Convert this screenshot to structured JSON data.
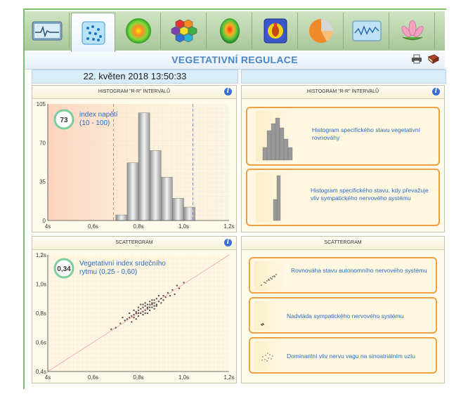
{
  "app": {
    "title": "VEGETATIVNÍ REGULACE",
    "date_left": "22. květen 2018 13:50:33"
  },
  "toolbar": {
    "buttons": [
      {
        "icon": "ecg-monitor-icon"
      },
      {
        "icon": "scatter-dots-icon",
        "active": true
      },
      {
        "icon": "green-circle-icon"
      },
      {
        "icon": "hexagon-cluster-icon"
      },
      {
        "icon": "heatmap-head-icon"
      },
      {
        "icon": "chakra-body-icon"
      },
      {
        "icon": "pie-chart-icon"
      },
      {
        "icon": "waveform-icon"
      },
      {
        "icon": "lotus-icon"
      }
    ]
  },
  "histogram_left": {
    "header": "HISTOGRAM \"R-R\" INTERVALŮ",
    "index_value": "73",
    "index_label_line1": "index napětí",
    "index_label_line2": "(10 - 100)"
  },
  "histogram_right": {
    "header": "HISTOGRAM \"R-R\" INTERVALŮ",
    "card1": "Histogram specifického stavu vegetativní rovnováhy",
    "card2": "Histogram specifického stavu, kdy převažuje vliv sympatického nervového systému"
  },
  "scatter_left": {
    "header": "SCATTERGRAM",
    "index_value": "0,34",
    "index_label_line1": "Vegetativní index srdečního",
    "index_label_line2": "rytmu (0,25 - 0,60)"
  },
  "scatter_right": {
    "header": "SCATTERGRAM",
    "card1": "Rovnováha stavu autonomního nervového systému",
    "card2": "Nadvláda sympatického nervového systému",
    "card3": "Dominantní vliv nervu vagu na sinoatriálním uzlu"
  },
  "chart_data": [
    {
      "type": "bar",
      "x_ticks": [
        "4s",
        "0,6s",
        "0,8s",
        "1,0s",
        "1,2s"
      ],
      "y_ticks": [
        "0",
        "35",
        "70",
        "105"
      ],
      "ylim": [
        0,
        105
      ],
      "xlim": [
        0.4,
        1.2
      ],
      "bin_width": 0.05,
      "bins_start": [
        0.7,
        0.75,
        0.8,
        0.85,
        0.9,
        0.95,
        1.0
      ],
      "values": [
        5,
        52,
        97,
        63,
        39,
        20,
        12
      ],
      "ref_lines_x": [
        0.69,
        1.04
      ]
    },
    {
      "type": "scatter",
      "x_ticks": [
        "4s",
        "0,6s",
        "0,8s",
        "1,0s",
        "1,2s"
      ],
      "y_ticks": [
        "0,4s",
        "0,6s",
        "0,8s",
        "1,0s",
        "1,2s"
      ],
      "xlim": [
        0.4,
        1.2
      ],
      "ylim": [
        0.4,
        1.2
      ],
      "points": [
        [
          0.8,
          0.8
        ],
        [
          0.82,
          0.81
        ],
        [
          0.84,
          0.83
        ],
        [
          0.85,
          0.84
        ],
        [
          0.83,
          0.85
        ],
        [
          0.86,
          0.87
        ],
        [
          0.81,
          0.83
        ],
        [
          0.79,
          0.8
        ],
        [
          0.78,
          0.79
        ],
        [
          0.88,
          0.86
        ],
        [
          0.87,
          0.89
        ],
        [
          0.89,
          0.88
        ],
        [
          0.9,
          0.9
        ],
        [
          0.84,
          0.86
        ],
        [
          0.86,
          0.84
        ],
        [
          0.82,
          0.84
        ],
        [
          0.8,
          0.82
        ],
        [
          0.77,
          0.78
        ],
        [
          0.76,
          0.77
        ],
        [
          0.75,
          0.76
        ],
        [
          0.83,
          0.82
        ],
        [
          0.85,
          0.86
        ],
        [
          0.87,
          0.85
        ],
        [
          0.91,
          0.92
        ],
        [
          0.92,
          0.91
        ],
        [
          0.81,
          0.8
        ],
        [
          0.79,
          0.81
        ],
        [
          0.84,
          0.84
        ],
        [
          0.86,
          0.86
        ],
        [
          0.88,
          0.9
        ],
        [
          0.93,
          0.94
        ],
        [
          0.95,
          0.96
        ],
        [
          0.74,
          0.75
        ],
        [
          0.73,
          0.77
        ],
        [
          0.82,
          0.79
        ],
        [
          0.8,
          0.78
        ],
        [
          0.85,
          0.82
        ],
        [
          0.83,
          0.87
        ],
        [
          0.78,
          0.82
        ],
        [
          0.9,
          0.87
        ],
        [
          0.96,
          0.93
        ],
        [
          0.97,
          0.99
        ],
        [
          0.72,
          0.73
        ],
        [
          0.7,
          0.7
        ],
        [
          0.87,
          0.83
        ],
        [
          0.81,
          0.86
        ],
        [
          0.84,
          0.8
        ],
        [
          0.89,
          0.92
        ],
        [
          0.76,
          0.8
        ],
        [
          0.79,
          0.76
        ],
        [
          0.86,
          0.89
        ],
        [
          0.88,
          0.85
        ],
        [
          0.83,
          0.8
        ],
        [
          0.8,
          0.84
        ],
        [
          0.77,
          0.74
        ],
        [
          0.91,
          0.89
        ],
        [
          0.94,
          0.92
        ],
        [
          0.98,
          0.97
        ],
        [
          1.0,
          1.01
        ],
        [
          0.68,
          0.69
        ],
        [
          0.82,
          0.86
        ],
        [
          0.85,
          0.88
        ],
        [
          0.87,
          0.87
        ],
        [
          0.78,
          0.77
        ]
      ],
      "identity_line": true
    }
  ]
}
